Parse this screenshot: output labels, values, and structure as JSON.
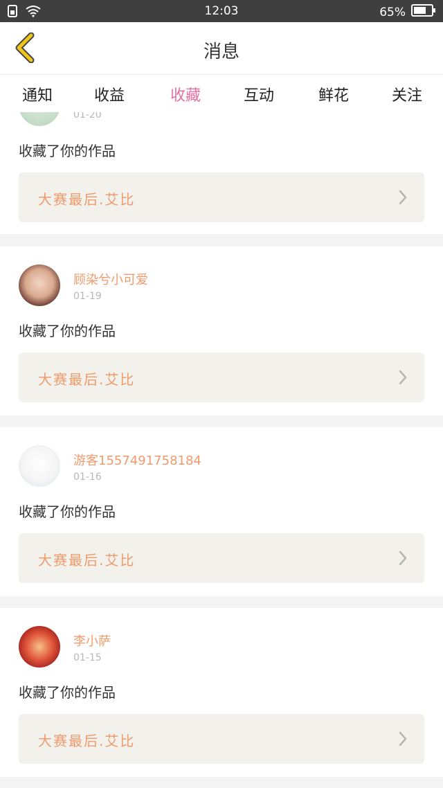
{
  "status_bar": {
    "time": "12:03",
    "battery": "65%"
  },
  "header": {
    "title": "消息",
    "back_icon": "chevron-left-icon",
    "accent_color": "#f0c419"
  },
  "tabs": [
    {
      "label": "通知",
      "active": false
    },
    {
      "label": "收益",
      "active": false
    },
    {
      "label": "收藏",
      "active": true
    },
    {
      "label": "互动",
      "active": false
    },
    {
      "label": "鲜花",
      "active": false
    },
    {
      "label": "关注",
      "active": false
    }
  ],
  "active_tab_color": "#e86fa4",
  "partial_card": {
    "date": "01-20",
    "action": "收藏了你的作品",
    "work_title": "大赛最后.艾比"
  },
  "cards": [
    {
      "name": "顾染兮小可爱",
      "date": "01-19",
      "action": "收藏了你的作品",
      "work_title": "大赛最后.艾比"
    },
    {
      "name": "游客1557491758184",
      "date": "01-16",
      "action": "收藏了你的作品",
      "work_title": "大赛最后.艾比"
    },
    {
      "name": "李小萨",
      "date": "01-15",
      "action": "收藏了你的作品",
      "work_title": "大赛最后.艾比"
    }
  ],
  "colors": {
    "name": "#ef9a6b",
    "work_bg": "#f2f1ec",
    "status_bar": "#3f3f3f"
  }
}
